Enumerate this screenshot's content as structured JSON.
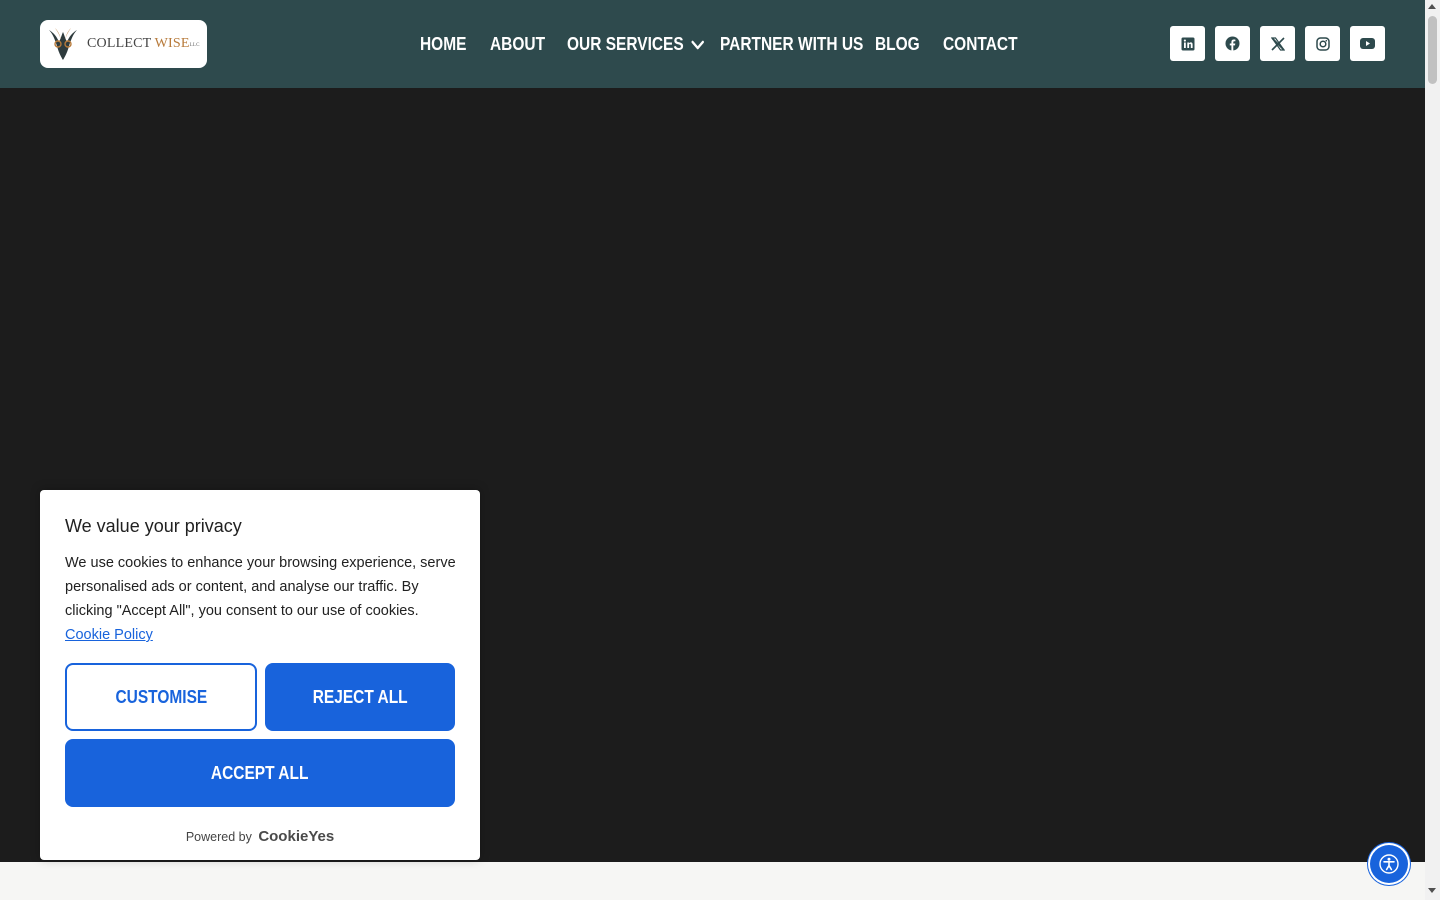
{
  "brand": {
    "name_part1": "COLLECT ",
    "name_part2": "WISE",
    "suffix": "LLC",
    "accent_color": "#b77a3a"
  },
  "nav": {
    "items": [
      {
        "label": "HOME"
      },
      {
        "label": "ABOUT"
      },
      {
        "label": "OUR SERVICES",
        "icon": "chevron-down-icon"
      },
      {
        "label": "PARTNER WITH US"
      },
      {
        "label": "BLOG"
      },
      {
        "label": "CONTACT"
      }
    ]
  },
  "social": [
    {
      "icon": "linkedin-icon"
    },
    {
      "icon": "facebook-icon"
    },
    {
      "icon": "x-twitter-icon"
    },
    {
      "icon": "instagram-icon"
    },
    {
      "icon": "youtube-icon"
    }
  ],
  "cookie_banner": {
    "title": "We value your privacy",
    "body": "We use cookies to enhance your browsing experience, serve personalised ads or content, and analyse our traffic. By clicking \"Accept All\", you consent to our use of cookies.",
    "policy_link": "Cookie Policy",
    "customise_label": "CUSTOMISE",
    "reject_label": "REJECT ALL",
    "accept_label": "ACCEPT ALL",
    "powered_by": "Powered by",
    "powered_brand": "CookieYes",
    "accent_color": "#1863dc"
  },
  "colors": {
    "header_bg": "#2e4a4d",
    "hero_bg": "#1c1c1c"
  }
}
